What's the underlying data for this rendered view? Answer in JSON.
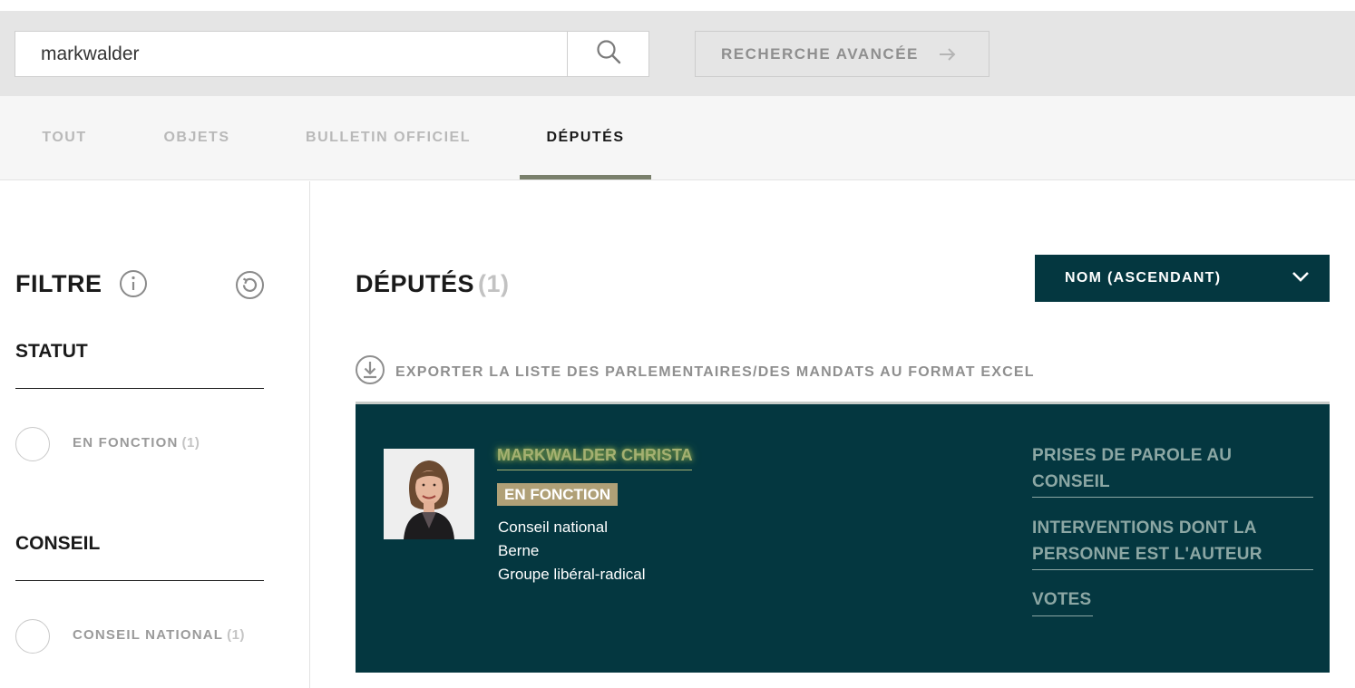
{
  "search": {
    "value": "markwalder",
    "advanced_label": "RECHERCHE AVANCÉE"
  },
  "tabs": [
    {
      "label": "TOUT",
      "active": false
    },
    {
      "label": "OBJETS",
      "active": false
    },
    {
      "label": "BULLETIN OFFICIEL",
      "active": false
    },
    {
      "label": "DÉPUTÉS",
      "active": true
    }
  ],
  "sidebar": {
    "title": "FILTRE",
    "sections": [
      {
        "title": "STATUT",
        "options": [
          {
            "label": "EN FONCTION",
            "count": "(1)"
          }
        ]
      },
      {
        "title": "CONSEIL",
        "options": [
          {
            "label": "CONSEIL NATIONAL",
            "count": "(1)"
          }
        ]
      }
    ]
  },
  "main": {
    "title": "DÉPUTÉS",
    "count": "(1)",
    "sort_label": "NOM (ASCENDANT)",
    "export_label": "EXPORTER LA LISTE DES PARLEMENTAIRES/DES MANDATS AU FORMAT EXCEL"
  },
  "deputy": {
    "name": "MARKWALDER CHRISTA",
    "status": "EN FONCTION",
    "council": "Conseil national",
    "canton": "Berne",
    "group": "Groupe libéral-radical",
    "links": {
      "speeches_line1": "PRISES DE PAROLE AU",
      "speeches_line2": "CONSEIL",
      "interventions_line1": "INTERVENTIONS DONT LA",
      "interventions_line2": "PERSONNE EST L'AUTEUR",
      "votes": "VOTES"
    }
  },
  "colors": {
    "card_bg": "#043740",
    "sort_bg": "#043740",
    "name_link": "#a4b071",
    "badge_bg": "#b0a077",
    "tab_underline": "#7a806c",
    "side_links": "#8ca7a4"
  }
}
